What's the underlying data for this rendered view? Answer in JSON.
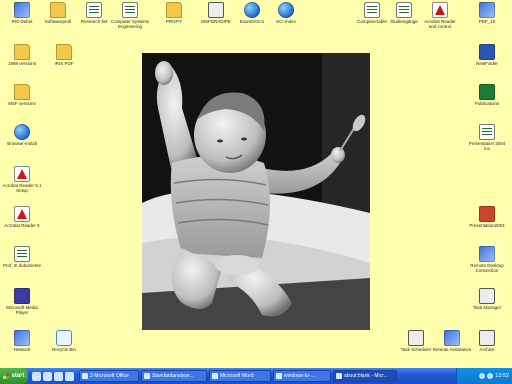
{
  "desktop": {
    "background": "#FFFFAE",
    "icons": [
      {
        "label": "RIS-Debut",
        "type": "app"
      },
      {
        "label": "Softwareprofi",
        "type": "folder"
      },
      {
        "label": "Research-list",
        "type": "doc"
      },
      {
        "label": "Computer Systems Engineering",
        "type": "doc"
      },
      {
        "label": "PROFIT",
        "type": "folder"
      },
      {
        "label": "MSFDRADIPE",
        "type": "task"
      },
      {
        "label": "ExamDOCS",
        "type": "globe"
      },
      {
        "label": "SCI Index",
        "type": "globe"
      },
      {
        "label": "Compare-table",
        "type": "doc"
      },
      {
        "label": "Studiengänge",
        "type": "doc"
      },
      {
        "label": "Acrobat Reader and control",
        "type": "pdf"
      },
      {
        "label": "PDF_10",
        "type": "app"
      },
      {
        "label": "1998 versions",
        "type": "folder"
      },
      {
        "label": "IRIS PDF",
        "type": "folder"
      },
      {
        "label": "NewFolder",
        "type": "word"
      },
      {
        "label": "MSF versions",
        "type": "folder"
      },
      {
        "label": "Publications",
        "type": "excel"
      },
      {
        "label": "Browser-install",
        "type": "globe"
      },
      {
        "label": "Presentation 2004 ins",
        "type": "doc"
      },
      {
        "label": "Acrobat Reader 5.1 Setup",
        "type": "pdf"
      },
      {
        "label": "Acrobat Reader 6",
        "type": "pdf"
      },
      {
        "label": "Presentation2004",
        "type": "ppt"
      },
      {
        "label": "Prof. III dokumente",
        "type": "doc"
      },
      {
        "label": "Microsoft Media Player",
        "type": "media"
      },
      {
        "label": "Remote Desktop Connection",
        "type": "app"
      },
      {
        "label": "Task Manager",
        "type": "task"
      },
      {
        "label": "Network",
        "type": "app"
      },
      {
        "label": "Recycle Bin",
        "type": "recycle"
      },
      {
        "label": "Task Scheduler",
        "type": "task"
      },
      {
        "label": "Remote Assistance",
        "type": "app"
      },
      {
        "label": "Archive",
        "type": "task"
      }
    ]
  },
  "taskbar": {
    "start_label": "start",
    "buttons": [
      {
        "label": "3 Microsoft Office"
      },
      {
        "label": "Standardanalyse..."
      },
      {
        "label": "Microsoft Word"
      },
      {
        "label": "windows-to-..."
      },
      {
        "label": "about:blank - Micr...",
        "active": true
      }
    ],
    "clock": "13:52"
  },
  "wallpaper_photo": {
    "subject": "baby-with-spoon-photo"
  }
}
